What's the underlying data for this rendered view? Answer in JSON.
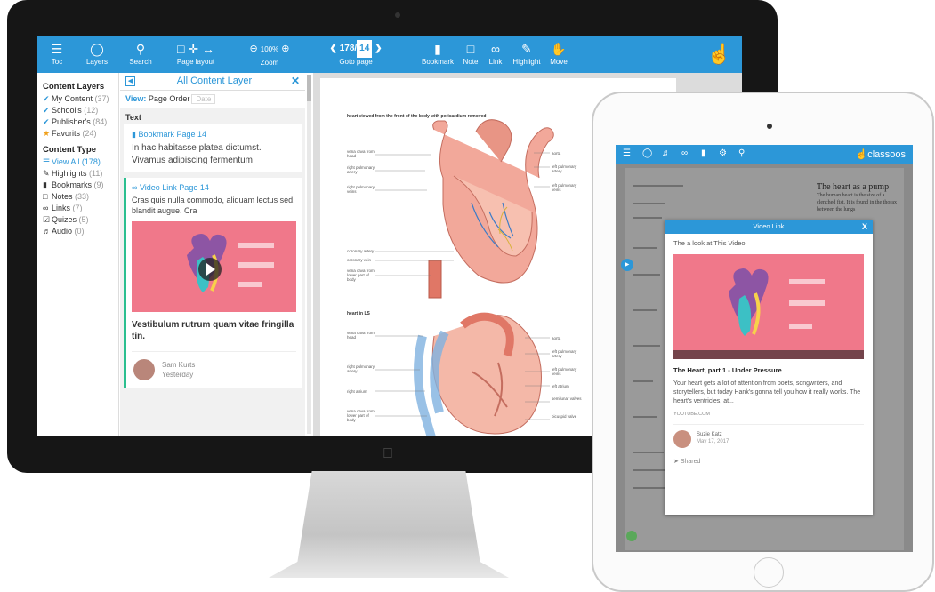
{
  "toolbar": {
    "toc": "Toc",
    "layers": "Layers",
    "search": "Search",
    "page_layout": "Page layout",
    "zoom_label": "Zoom",
    "zoom_value": "100%",
    "goto_label": "Goto page",
    "goto_total": "178/",
    "goto_current": "14",
    "bookmark": "Bookmark",
    "note": "Note",
    "link": "Link",
    "highlight": "Highlight",
    "move": "Move",
    "accent": "#2c97d8"
  },
  "left_panel": {
    "layers_title": "Content Layers",
    "layers": [
      {
        "label": "My Content",
        "count": "(37)"
      },
      {
        "label": "School's",
        "count": "(12)"
      },
      {
        "label": "Publisher's",
        "count": "(84)"
      },
      {
        "label": "Favorits",
        "count": "(24)"
      }
    ],
    "type_title": "Content Type",
    "types": [
      {
        "label": "View All",
        "count": "(178)"
      },
      {
        "label": "Highlights",
        "count": "(11)"
      },
      {
        "label": "Bookmarks",
        "count": "(9)"
      },
      {
        "label": "Notes",
        "count": "(33)"
      },
      {
        "label": "Links",
        "count": "(7)"
      },
      {
        "label": "Quizes",
        "count": "(5)"
      },
      {
        "label": "Audio",
        "count": "(0)"
      }
    ]
  },
  "middle_panel": {
    "title": "All Content Layer",
    "view_label": "View:",
    "view_value": "Page Order",
    "view_alt": "Date",
    "section": "Text",
    "bookmark_card": {
      "head": "Bookmark Page 14",
      "body": "In hac habitasse platea dictumst. Vivamus adipiscing fermentum"
    },
    "video_card": {
      "head": "Video Link Page 14",
      "body": "Cras quis nulla commodo, aliquam lectus sed, blandit augue. Cra",
      "title": "Vestibulum rutrum quam vitae fringilla tin.",
      "author": "Sam Kurts",
      "date": "Yesterday"
    }
  },
  "document": {
    "caption1": "heart viewed from the front of the body with pericardium removed",
    "caption2": "heart in LS",
    "labels_left_top": [
      "vena cava from head",
      "right pulmonary artery",
      "right pulmonary veins",
      "coronary artery",
      "coronary vein",
      "vena cava from lower part of body"
    ],
    "labels_right_top": [
      "aorta",
      "left pulmonary artery",
      "left pulmonary veins"
    ],
    "labels_left_bottom": [
      "vena cava from head",
      "right pulmonary artery",
      "right atrium",
      "vena cava from lower part of body"
    ],
    "labels_right_bottom": [
      "aorta",
      "left pulmonary artery",
      "left pulmonary veins",
      "left atrium",
      "semilunar valves",
      "bicuspid valve"
    ]
  },
  "ipad": {
    "logo": "classoos",
    "text_heading": "The heart as a pump",
    "text_body": "The human heart is the size of a clenched fist. It is found in the thorax between the lungs",
    "popup": {
      "header": "Video Link",
      "subtitle": "The a look at This Video",
      "video_title": "The Heart, part 1 - Under Pressure",
      "description": "Your heart gets a lot of attention from poets, songwriters, and storytellers, but today Hank's gonna tell you how it really works. The heart's ventricles, at...",
      "source": "YOUTUBE.COM",
      "author": "Suzie Katz",
      "date": "May 17, 2017",
      "shared": "Shared"
    }
  }
}
